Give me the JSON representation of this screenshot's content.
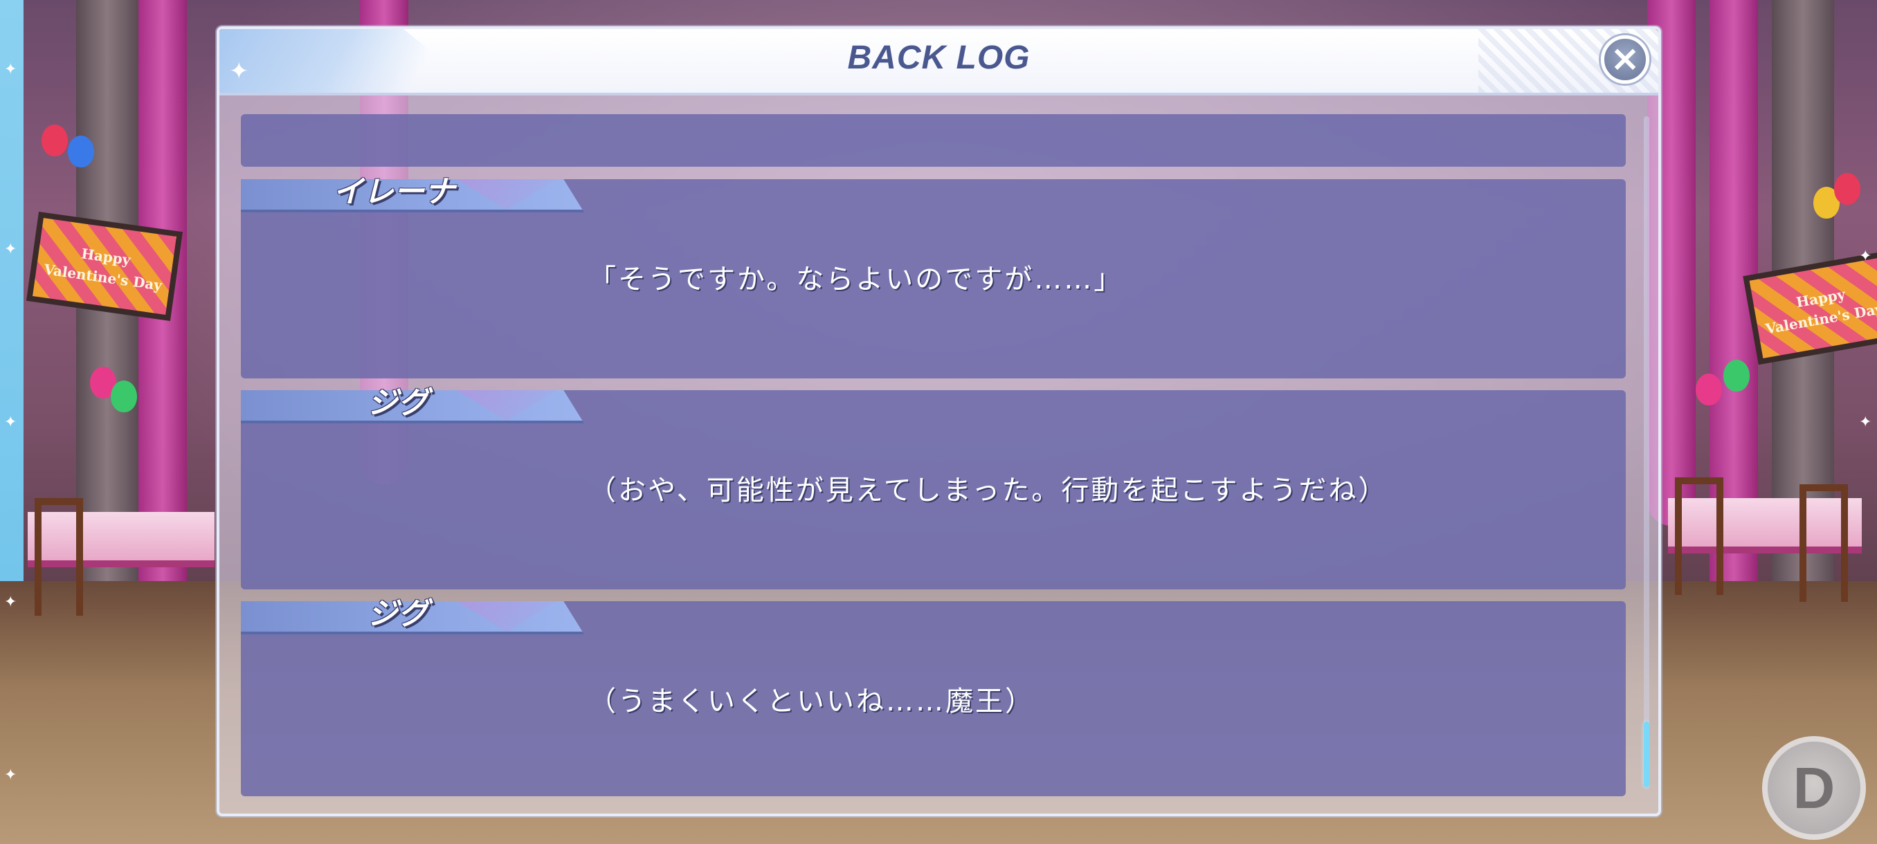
{
  "window": {
    "title": "BACK LOG",
    "close_icon": "close-icon"
  },
  "background": {
    "sign_text": "Happy Valentine's Day"
  },
  "log": {
    "entries": [
      {
        "speaker": "",
        "text": ""
      },
      {
        "speaker": "イレーナ",
        "text": "「そうですか。ならよいのですが……」"
      },
      {
        "speaker": "ジグ",
        "text": "（おや、可能性が見えてしまった。行動を起こすようだね）"
      },
      {
        "speaker": "ジグ",
        "text": "（うまくいくといいね……魔王）"
      }
    ]
  },
  "corner_button": {
    "label": "D"
  },
  "colors": {
    "title": "#4a5890",
    "entry_bg": "#6c6aaa",
    "speaker_tag": "#8ea6e4",
    "scroll_thumb": "#7ad8f8"
  }
}
